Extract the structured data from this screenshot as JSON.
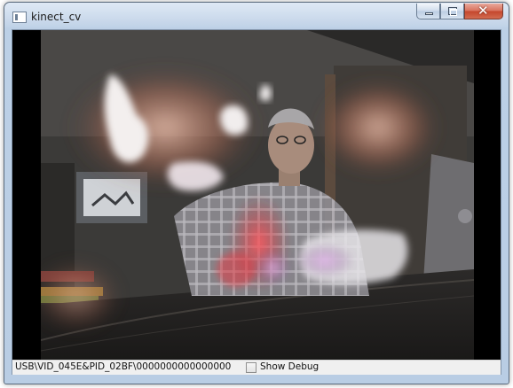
{
  "window": {
    "title": "kinect_cv",
    "app_icon": "application-icon",
    "controls": {
      "minimize_icon": "minimize-icon",
      "maximize_icon": "maximize-icon",
      "close_icon": "close-icon"
    }
  },
  "video": {
    "description_icon": "camera-feed"
  },
  "status_bar": {
    "device_path": "USB\\VID_045E&PID_02BF\\0000000000000000",
    "show_debug_label": "Show Debug",
    "show_debug_checked": false
  }
}
